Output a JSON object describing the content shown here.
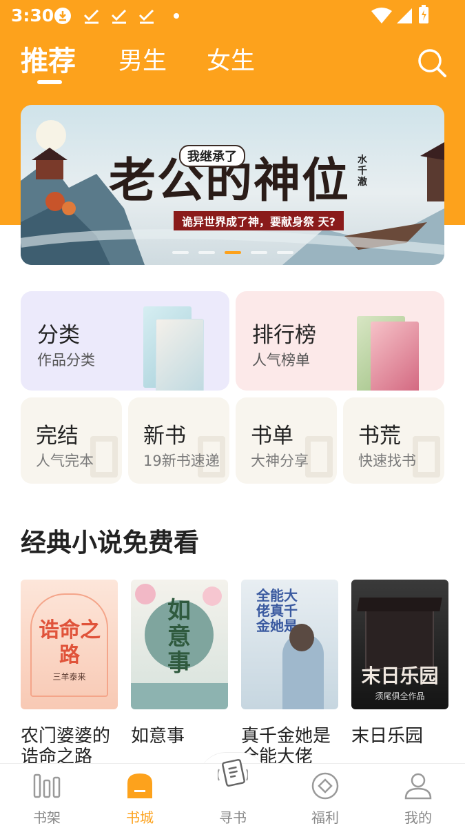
{
  "status_bar": {
    "time": "3:30"
  },
  "tabs": [
    {
      "label": "推荐",
      "active": true
    },
    {
      "label": "男生",
      "active": false
    },
    {
      "label": "女生",
      "active": false
    }
  ],
  "banner": {
    "tag": "我继承了",
    "title": "老公的神位",
    "subtitle": "诡异世界成了神，要献身祭 天?",
    "author": "水千澈",
    "slides": 5,
    "active_slide": 3
  },
  "categories": [
    {
      "title": "分类",
      "subtitle": "作品分类"
    },
    {
      "title": "排行榜",
      "subtitle": "人气榜单"
    }
  ],
  "shortcuts": [
    {
      "title": "完结",
      "subtitle": "人气完本"
    },
    {
      "title": "新书",
      "subtitle": "19新书速递"
    },
    {
      "title": "书单",
      "subtitle": "大神分享"
    },
    {
      "title": "书荒",
      "subtitle": "快速找书"
    }
  ],
  "section": {
    "title": "经典小说免费看"
  },
  "books": [
    {
      "name": "农门婆婆的诰命之路",
      "cover_text": "诰命之路",
      "cover_author": "三羊泰来"
    },
    {
      "name": "如意事",
      "cover_text": "如意事"
    },
    {
      "name": "真千金她是全能大佬",
      "cover_text": "全能大佬真千金她是"
    },
    {
      "name": "末日乐园",
      "cover_text": "末日乐园",
      "cover_author": "须尾俱全作品"
    }
  ],
  "nav": [
    {
      "label": "书架",
      "icon": "bookshelf-icon",
      "active": false
    },
    {
      "label": "书城",
      "icon": "bookstore-icon",
      "active": true
    },
    {
      "label": "寻书",
      "icon": "find-book-icon",
      "active": false
    },
    {
      "label": "福利",
      "icon": "welfare-icon",
      "active": false
    },
    {
      "label": "我的",
      "icon": "profile-icon",
      "active": false
    }
  ],
  "colors": {
    "accent": "#fda21c",
    "text": "#222222",
    "muted": "#888888"
  }
}
